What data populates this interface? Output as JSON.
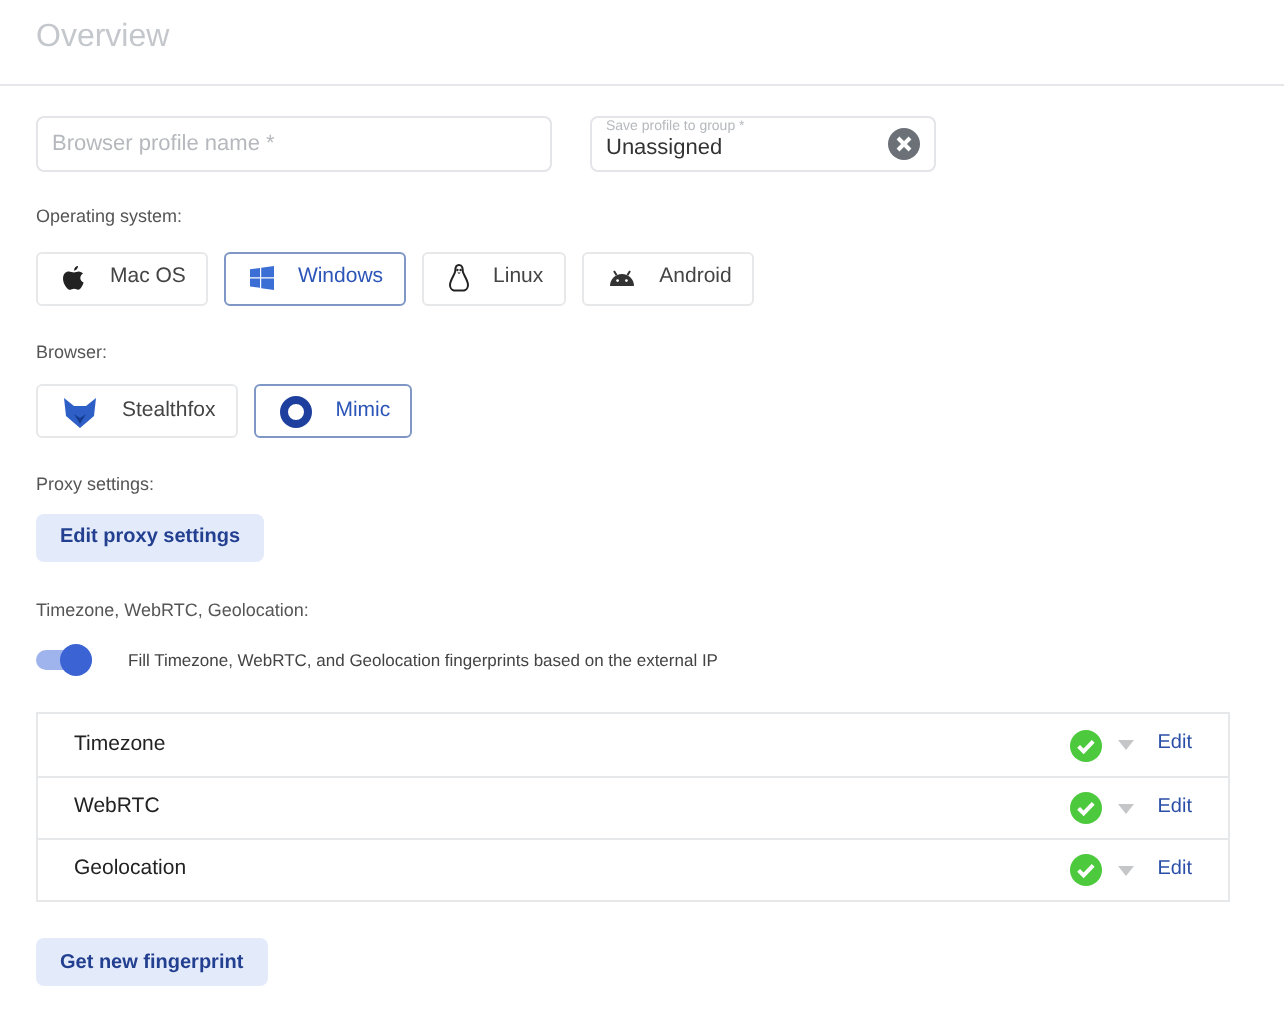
{
  "title": "Overview",
  "profile_name": {
    "placeholder": "Browser profile name *"
  },
  "group": {
    "label": "Save profile to group *",
    "value": "Unassigned"
  },
  "os": {
    "label": "Operating system:",
    "options": [
      {
        "kind": "apple",
        "label": "Mac OS",
        "selected": false
      },
      {
        "kind": "windows",
        "label": "Windows",
        "selected": true
      },
      {
        "kind": "linux",
        "label": "Linux",
        "selected": false
      },
      {
        "kind": "android",
        "label": "Android",
        "selected": false
      }
    ]
  },
  "browser": {
    "label": "Browser:",
    "options": [
      {
        "kind": "fox",
        "label": "Stealthfox",
        "selected": false
      },
      {
        "kind": "ring",
        "label": "Mimic",
        "selected": true
      }
    ]
  },
  "proxy": {
    "label": "Proxy settings:",
    "button": "Edit proxy settings"
  },
  "geo": {
    "label": "Timezone, WebRTC, Geolocation:",
    "toggle": {
      "on": true,
      "label": "Fill Timezone, WebRTC, and Geolocation fingerprints based on the external IP"
    }
  },
  "rows": [
    {
      "name": "Timezone",
      "ok": true,
      "action": "Edit"
    },
    {
      "name": "WebRTC",
      "ok": true,
      "action": "Edit"
    },
    {
      "name": "Geolocation",
      "ok": true,
      "action": "Edit"
    }
  ],
  "fingerprint_button": "Get new fingerprint"
}
